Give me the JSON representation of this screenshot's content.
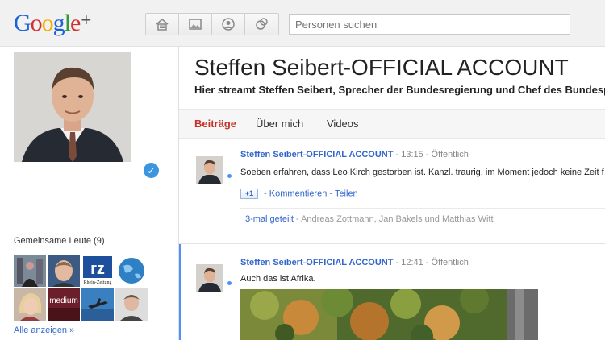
{
  "header": {
    "logo": {
      "letters": [
        "G",
        "o",
        "o",
        "g",
        "l",
        "e"
      ],
      "plus": "+"
    },
    "nav_icons": [
      "home-icon",
      "photos-icon",
      "profile-icon",
      "circles-icon"
    ],
    "search": {
      "placeholder": "Personen suchen",
      "value": ""
    }
  },
  "sidebar": {
    "common_people_label": "Gemeinsame Leute (9)",
    "show_all": "Alle anzeigen »",
    "thumb_texts": {
      "rz_big": "rz",
      "rz_small": "Rhein-Zeitung",
      "medium": "medium"
    }
  },
  "profile": {
    "name": "Steffen Seibert-OFFICIAL ACCOUNT",
    "tagline": "Hier streamt Steffen Seibert, Sprecher der Bundesregierung und Chef des Bundespresseamtes"
  },
  "tabs": [
    {
      "label": "Beiträge",
      "active": true
    },
    {
      "label": "Über mich",
      "active": false
    },
    {
      "label": "Videos",
      "active": false
    }
  ],
  "posts": [
    {
      "author": "Steffen Seibert-OFFICIAL ACCOUNT",
      "sep1": " - ",
      "time": "13:15",
      "sep2": " - ",
      "visibility": "Öffentlich",
      "text": "Soeben erfahren, dass Leo Kirch gestorben ist. Kanzl. traurig, im Moment jedoch keine Zeit f",
      "plusone": "+1",
      "comment": "Kommentieren",
      "share": "Teilen",
      "shared_count": "3-mal geteilt",
      "shared_by": " - Andreas Zottmann, Jan Bakels und Matthias Witt"
    },
    {
      "author": "Steffen Seibert-OFFICIAL ACCOUNT",
      "sep1": " - ",
      "time": "12:41",
      "sep2": " - ",
      "visibility": "Öffentlich",
      "text": "Auch das ist Afrika."
    }
  ],
  "colors": {
    "accent_blue": "#3366cc",
    "active_tab": "#c2332a",
    "verified": "#3d96dd"
  }
}
